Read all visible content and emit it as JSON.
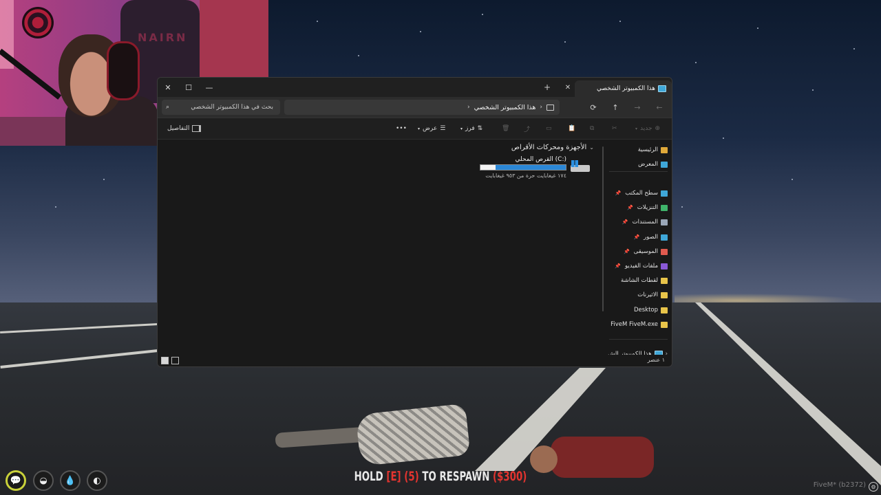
{
  "window": {
    "tab_title": "هذا الكمبيوتر الشخصي",
    "close_tab": "✕",
    "new_tab": "+",
    "minimize": "—",
    "maximize": "☐",
    "close": "✕"
  },
  "address": {
    "path": "هذا الكمبيوتر الشخصي",
    "search_placeholder": "بحث في هذا الكمبيوتر الشخصي"
  },
  "toolbar": {
    "new_label": "جديد",
    "sort_label": "فرز",
    "view_label": "عرض",
    "more_label": "•••",
    "details_label": "التفاصيل"
  },
  "content": {
    "group_header": "الأجهزة ومحركات الأقراص",
    "drive": {
      "name": "القرص المحلي (C:)",
      "space": "١٧٤ غيغابايت حرة من ٩٥٣ غيغابايت",
      "used_fraction": 0.82
    }
  },
  "nav_pane": {
    "items": [
      {
        "label": "الرئيسية",
        "icon": "home-icon",
        "color": "#e0a93a"
      },
      {
        "label": "المعرض",
        "icon": "gallery-icon",
        "color": "#3fa7d8"
      },
      {
        "label": "سطح المكتب",
        "icon": "desktop-icon",
        "color": "#3fa7d8",
        "pinned": true
      },
      {
        "label": "التنزيلات",
        "icon": "download-icon",
        "color": "#3fb46b",
        "pinned": true
      },
      {
        "label": "المستندات",
        "icon": "document-icon",
        "color": "#9aa7b8",
        "pinned": true
      },
      {
        "label": "الصور",
        "icon": "pictures-icon",
        "color": "#3fa7d8",
        "pinned": true
      },
      {
        "label": "الموسيقى",
        "icon": "music-icon",
        "color": "#e05a4f",
        "pinned": true
      },
      {
        "label": "ملفات الفيديو",
        "icon": "video-icon",
        "color": "#8a58d6",
        "pinned": true
      },
      {
        "label": "لقطات الشاشة",
        "icon": "folder-icon",
        "color": "#e8c44a"
      },
      {
        "label": "الاثيرنات",
        "icon": "folder-icon",
        "color": "#e8c44a"
      },
      {
        "label": "Desktop",
        "icon": "folder-icon",
        "color": "#e8c44a"
      },
      {
        "label": "FiveM FiveM.exe",
        "icon": "folder-icon",
        "color": "#e8c44a"
      }
    ],
    "this_pc": "هذا الكمبيوتر الش"
  },
  "status": {
    "count": "١ عنصر"
  },
  "webcam": {
    "chair_text": "NAIRN"
  },
  "hud": {
    "respawn_hold": "HOLD ",
    "respawn_key": "[E]",
    "respawn_timer": "(5)",
    "respawn_to": " TO RESPAWN ",
    "respawn_cost": "($300)",
    "fivem_tag": "FiveM* (b2372)"
  }
}
